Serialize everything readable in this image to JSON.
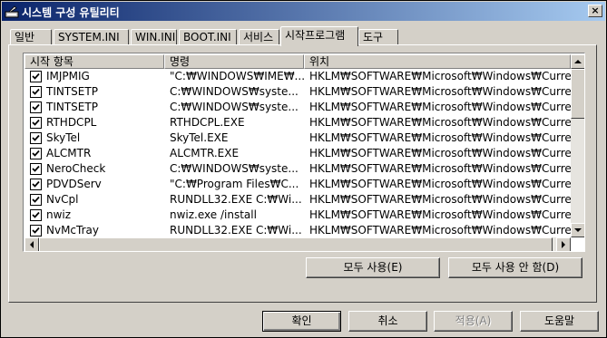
{
  "window": {
    "title": "시스템 구성 유틸리티",
    "close_label": "×"
  },
  "tabs": [
    {
      "label": "일반"
    },
    {
      "label": "SYSTEM.INI"
    },
    {
      "label": "WIN.INI"
    },
    {
      "label": "BOOT.INI"
    },
    {
      "label": "서비스"
    },
    {
      "label": "시작프로그램"
    },
    {
      "label": "도구"
    }
  ],
  "active_tab": "시작프로그램",
  "list": {
    "columns": [
      "시작 항목",
      "명령",
      "위치"
    ],
    "rows": [
      {
        "checked": true,
        "item": "IMJPMIG",
        "command": "\"C:₩WINDOWS₩IME₩...",
        "location": "HKLM₩SOFTWARE₩Microsoft₩Windows₩Curre..."
      },
      {
        "checked": true,
        "item": "TINTSETP",
        "command": "C:₩WINDOWS₩syste...",
        "location": "HKLM₩SOFTWARE₩Microsoft₩Windows₩Curre..."
      },
      {
        "checked": true,
        "item": "TINTSETP",
        "command": "C:₩WINDOWS₩syste...",
        "location": "HKLM₩SOFTWARE₩Microsoft₩Windows₩Curre..."
      },
      {
        "checked": true,
        "item": "RTHDCPL",
        "command": "RTHDCPL.EXE",
        "location": "HKLM₩SOFTWARE₩Microsoft₩Windows₩Curre..."
      },
      {
        "checked": true,
        "item": "SkyTel",
        "command": "SkyTel.EXE",
        "location": "HKLM₩SOFTWARE₩Microsoft₩Windows₩Curre..."
      },
      {
        "checked": true,
        "item": "ALCMTR",
        "command": "ALCMTR.EXE",
        "location": "HKLM₩SOFTWARE₩Microsoft₩Windows₩Curre..."
      },
      {
        "checked": true,
        "item": "NeroCheck",
        "command": "C:₩WINDOWS₩syste...",
        "location": "HKLM₩SOFTWARE₩Microsoft₩Windows₩Curre..."
      },
      {
        "checked": true,
        "item": "PDVDServ",
        "command": "\"C:₩Program Files₩C...",
        "location": "HKLM₩SOFTWARE₩Microsoft₩Windows₩Curre..."
      },
      {
        "checked": true,
        "item": "NvCpl",
        "command": "RUNDLL32.EXE C:₩Wi...",
        "location": "HKLM₩SOFTWARE₩Microsoft₩Windows₩Curre..."
      },
      {
        "checked": true,
        "item": "nwiz",
        "command": "nwiz.exe /install",
        "location": "HKLM₩SOFTWARE₩Microsoft₩Windows₩Curre..."
      },
      {
        "checked": true,
        "item": "NvMcTray",
        "command": "RUNDLL32.EXE C:₩Wi...",
        "location": "HKLM₩SOFTWARE₩Microsoft₩Windows₩Curre..."
      }
    ]
  },
  "panel_buttons": {
    "enable_all": "모두 사용(E)",
    "disable_all": "모두 사용 안 함(D)"
  },
  "dialog_buttons": {
    "ok": "확인",
    "cancel": "취소",
    "apply": "적용(A)",
    "help": "도움말"
  }
}
